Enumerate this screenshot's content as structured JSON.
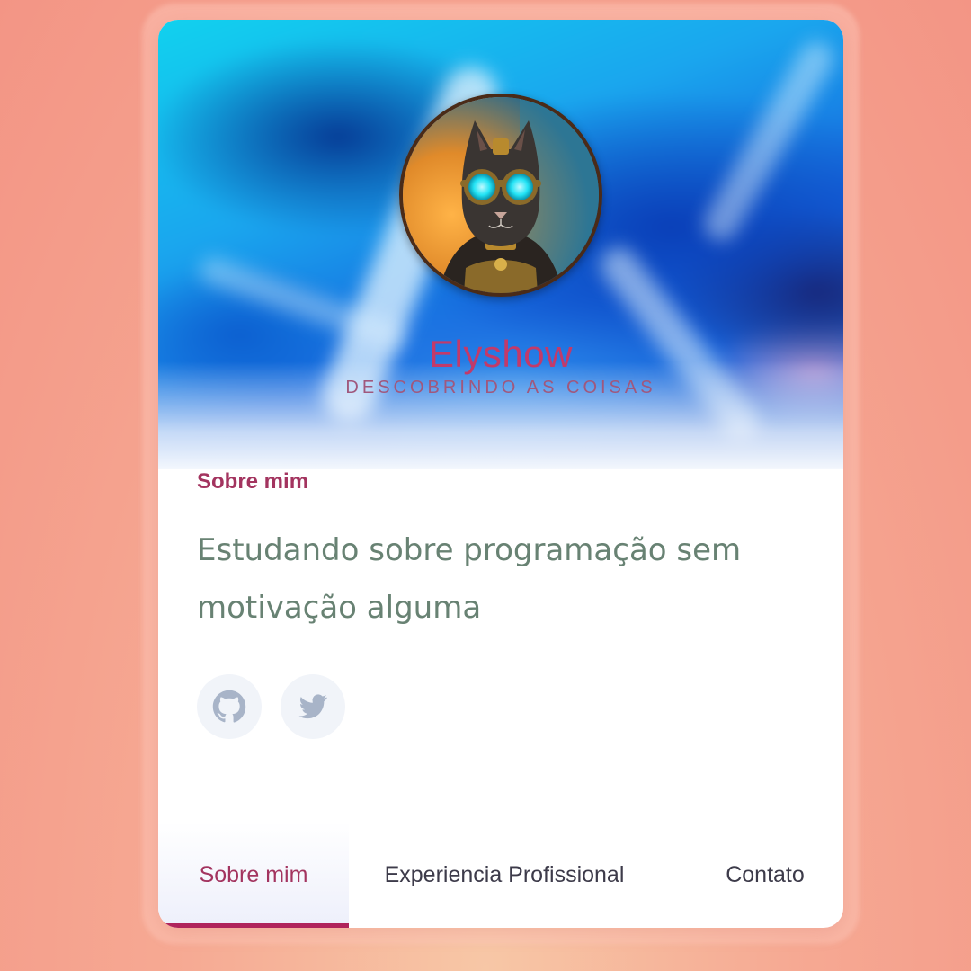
{
  "profile": {
    "name": "Elyshow",
    "tagline": "DESCOBRINDO AS COISAS"
  },
  "about": {
    "title": "Sobre mim",
    "text": "Estudando sobre programação sem motivação alguma"
  },
  "social": [
    {
      "icon": "github-icon",
      "label": "GitHub"
    },
    {
      "icon": "twitter-icon",
      "label": "Twitter"
    }
  ],
  "tabs": [
    {
      "label": "Sobre mim",
      "active": true
    },
    {
      "label": "Experiencia Profissional",
      "active": false
    },
    {
      "label": "Contato",
      "active": false
    }
  ],
  "colors": {
    "accent": "#b0245c",
    "name": "#c23a6a",
    "bio_text": "#688273",
    "background": "#f6a993"
  }
}
